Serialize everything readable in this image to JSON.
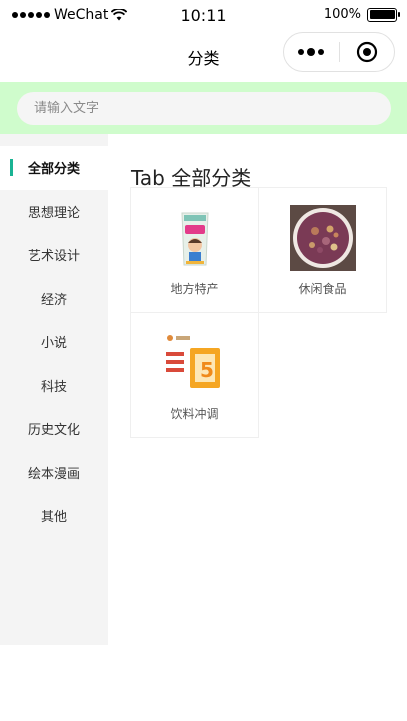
{
  "status_bar": {
    "carrier": "WeChat",
    "time": "10:11",
    "battery": "100%",
    "battery_level": 1.0
  },
  "nav": {
    "title": "分类"
  },
  "search": {
    "placeholder": "请输入文字"
  },
  "sidebar": {
    "items": [
      {
        "label": "全部分类",
        "active": true
      },
      {
        "label": "思想理论"
      },
      {
        "label": "艺术设计"
      },
      {
        "label": "经济"
      },
      {
        "label": "小说"
      },
      {
        "label": "科技"
      },
      {
        "label": "历史文化"
      },
      {
        "label": "绘本漫画"
      },
      {
        "label": "其他"
      }
    ]
  },
  "content": {
    "title": "Tab 全部分类",
    "categories": [
      {
        "label": "地方特产",
        "icon": "snack-bag-image"
      },
      {
        "label": "休闲食品",
        "icon": "porridge-bowl-image"
      },
      {
        "label": "饮料冲调",
        "icon": "drink-box-image"
      }
    ]
  },
  "colors": {
    "search_band": "#cffccc",
    "active_indicator": "#19b393",
    "sidebar_bg": "#f4f4f4"
  }
}
